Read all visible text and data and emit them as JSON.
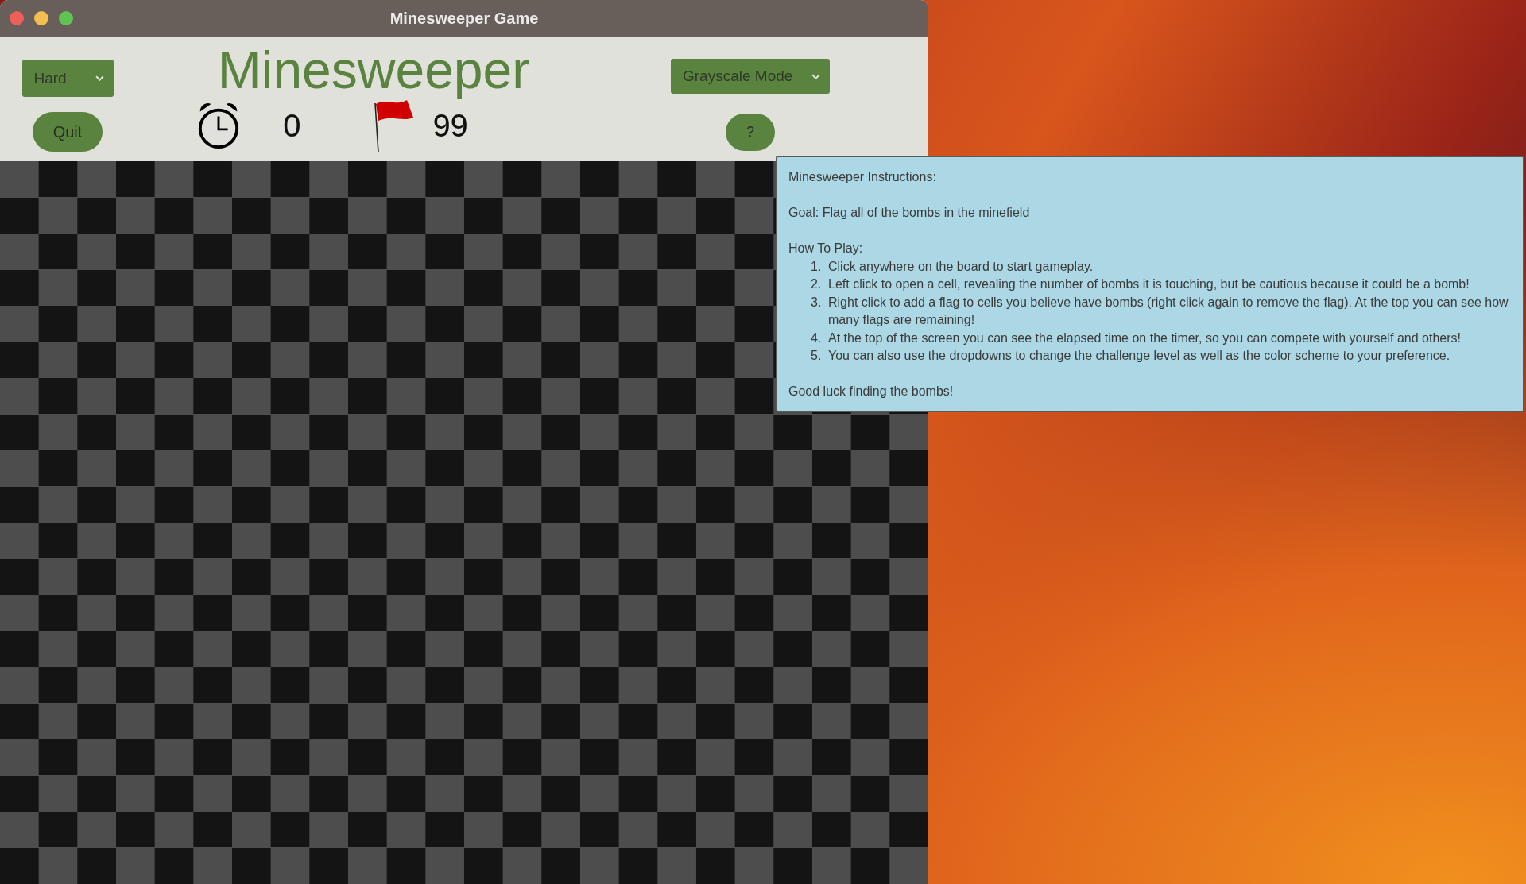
{
  "window": {
    "title": "Minesweeper Game"
  },
  "header": {
    "difficulty": {
      "value": "Hard"
    },
    "quit_button": "Quit",
    "title": "Minesweeper",
    "timer": "0",
    "flags_remaining": "99",
    "color_mode": {
      "value": "Grayscale Mode"
    },
    "help_button": "?"
  },
  "instructions": {
    "heading": "Minesweeper Instructions:",
    "goal": "Goal: Flag all of the bombs in the minefield",
    "how_to_heading": "How To Play:",
    "steps": [
      {
        "number": "1.",
        "text": "Click anywhere on the board to start gameplay."
      },
      {
        "number": "2.",
        "text": "Left click to open a cell, revealing the number of bombs it is touching, but be cautious because it could be a bomb!"
      },
      {
        "number": "3.",
        "text": "Right click to add a flag to cells you believe have bombs (right click again to remove the flag). At the top you can see how many flags are remaining!"
      },
      {
        "number": "4.",
        "text": "At the top of the screen you can see the elapsed time on the timer, so you can compete with yourself and others!"
      },
      {
        "number": "5.",
        "text": "You can also use the dropdowns to change the challenge level as well as the color scheme to your preference."
      }
    ],
    "closing": "Good luck finding the bombs!"
  }
}
